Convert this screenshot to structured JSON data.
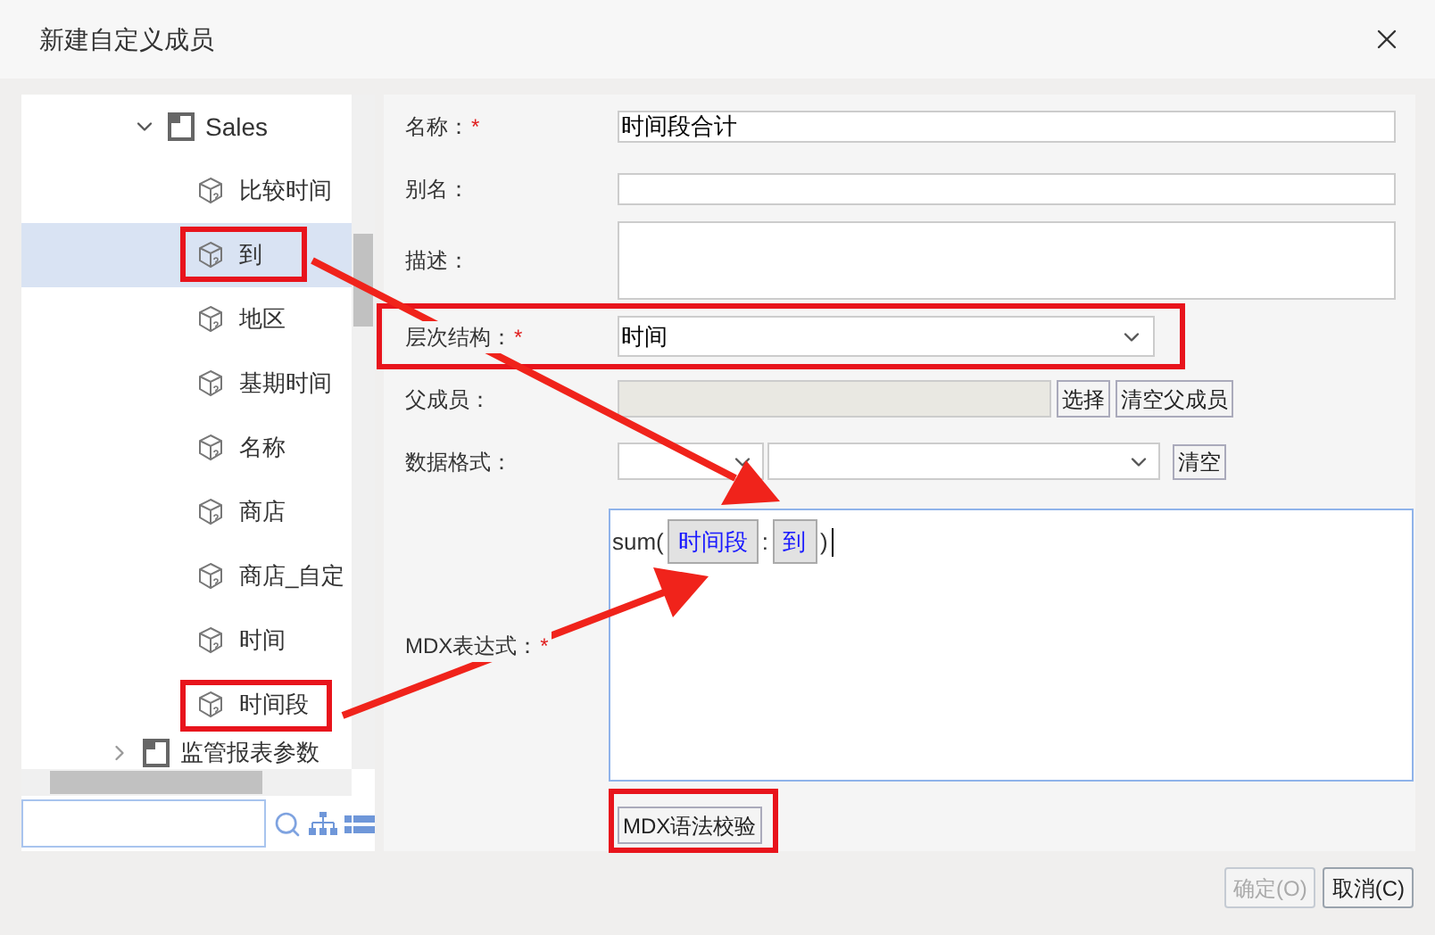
{
  "dialog": {
    "title": "新建自定义成员"
  },
  "tree": {
    "root": {
      "label": "Sales",
      "expanded": true,
      "children": [
        {
          "label": "比较时间",
          "selected": false
        },
        {
          "label": "到",
          "selected": true
        },
        {
          "label": "地区",
          "selected": false
        },
        {
          "label": "基期时间",
          "selected": false
        },
        {
          "label": "名称",
          "selected": false
        },
        {
          "label": "商店",
          "selected": false
        },
        {
          "label": "商店_自定",
          "selected": false
        },
        {
          "label": "时间",
          "selected": false
        },
        {
          "label": "时间段",
          "selected": false
        }
      ]
    },
    "next": {
      "label": "监管报表参数",
      "expanded": false
    }
  },
  "required_mark": "*",
  "form": {
    "fields": [
      {
        "kind": "text",
        "label": "名称：",
        "required": true,
        "value": "时间段合计"
      },
      {
        "kind": "text",
        "label": "别名：",
        "required": false
      },
      {
        "kind": "textarea",
        "label": "描述：",
        "required": false
      },
      {
        "kind": "select",
        "label": "层次结构：",
        "required": true,
        "value": "时间"
      },
      {
        "kind": "parent",
        "label": "父成员：",
        "required": false,
        "disabled": true,
        "buttons": [
          "选择",
          "清空父成员"
        ]
      },
      {
        "kind": "format",
        "label": "数据格式：",
        "required": false,
        "button": "清空"
      },
      {
        "kind": "mdx",
        "label": "MDX表达式：",
        "required": true,
        "tokens": [
          {
            "kind": "text",
            "text": "sum("
          },
          {
            "kind": "member",
            "text": "时间段"
          },
          {
            "kind": "text",
            "text": ":"
          },
          {
            "kind": "member",
            "text": "到"
          },
          {
            "kind": "text",
            "text": ")"
          }
        ]
      }
    ]
  },
  "check_button": "MDX语法校验",
  "footer": [
    {
      "label": "确定(O)",
      "disabled": true
    },
    {
      "label": "取消(C)",
      "disabled": false
    }
  ]
}
